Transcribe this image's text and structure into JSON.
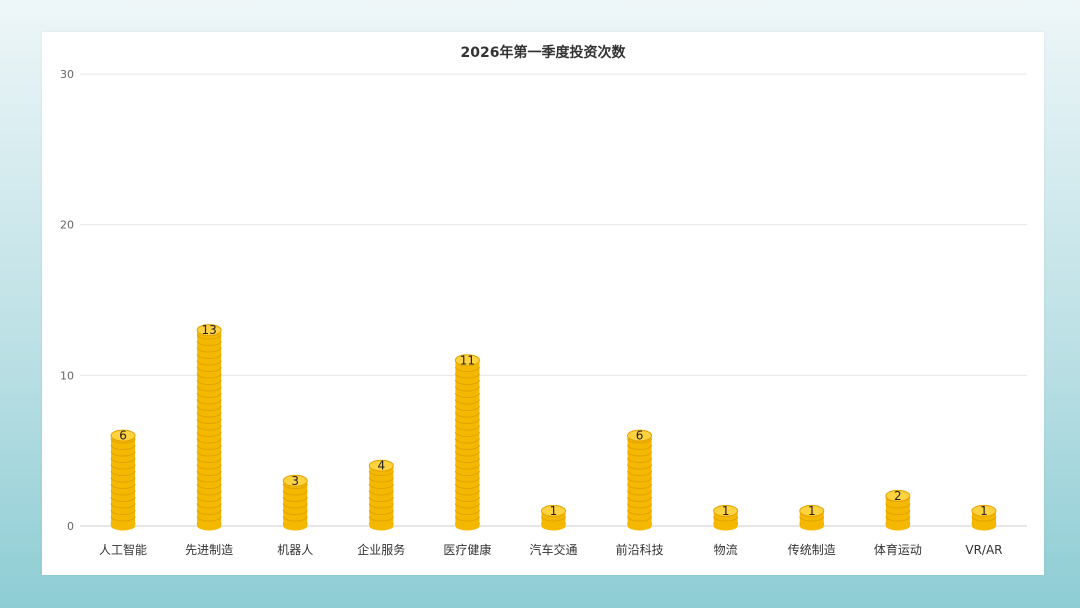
{
  "chart_data": {
    "type": "bar",
    "title": "2026年第一季度投资次数",
    "xlabel": "",
    "ylabel": "",
    "ylim": [
      0,
      30
    ],
    "yticks": [
      0,
      10,
      20,
      30
    ],
    "grid": true,
    "categories": [
      "人工智能",
      "先进制造",
      "机器人",
      "企业服务",
      "医疗健康",
      "汽车交通",
      "前沿科技",
      "物流",
      "传统制造",
      "体育运动",
      "VR/AR"
    ],
    "values": [
      6,
      13,
      3,
      4,
      11,
      1,
      6,
      1,
      1,
      2,
      1
    ],
    "bar_style": "stacked-coins",
    "colors": {
      "coin": "#f5b800",
      "coin_edge": "#e0a100",
      "coin_top": "#ffd23f",
      "grid": "#e6e6e6",
      "axis": "#cccccc"
    }
  }
}
